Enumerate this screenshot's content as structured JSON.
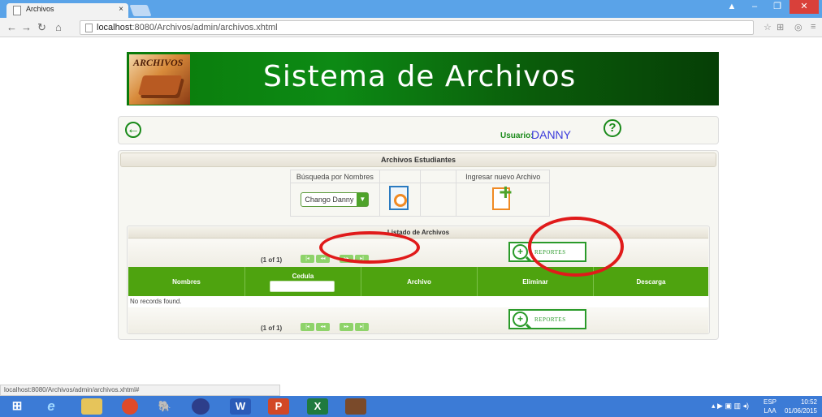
{
  "browser": {
    "tab_title": "Archivos",
    "tab_close": "×",
    "url_host": "localhost",
    "url_rest": ":8080/Archivos/admin/archivos.xhtml",
    "status_text": "localhost:8080/Archivos/admin/archivos.xhtml#"
  },
  "banner": {
    "logo_text": "ARCHIVOS",
    "title": "Sistema de Archivos"
  },
  "userbar": {
    "user_label": "Usuario:",
    "user_name": "DANNY"
  },
  "panel": {
    "title": "Archivos Estudiantes",
    "search_header": "Búsqueda por Nombres",
    "new_header": "Ingresar nuevo Archivo",
    "dropdown_value": "Chango Danny"
  },
  "list": {
    "title": "Listado de Archivos",
    "page_info_top": "(1 of 1)",
    "page_info_bottom": "(1 of 1)",
    "report_label": "REPORTES",
    "columns": {
      "nombres": "Nombres",
      "cedula": "Cedula",
      "archivo": "Archivo",
      "eliminar": "Eliminar",
      "descarga": "Descarga"
    },
    "empty_message": "No records found."
  },
  "taskbar": {
    "lang": "ESP",
    "lang2": "LAA",
    "time": "10:52",
    "date": "01/06/2015"
  },
  "colors": {
    "accent_green": "#4ea30f",
    "banner_green": "#0a7a0a",
    "annotation_red": "#e01a1a",
    "taskbar_blue": "#3c7bd6"
  }
}
